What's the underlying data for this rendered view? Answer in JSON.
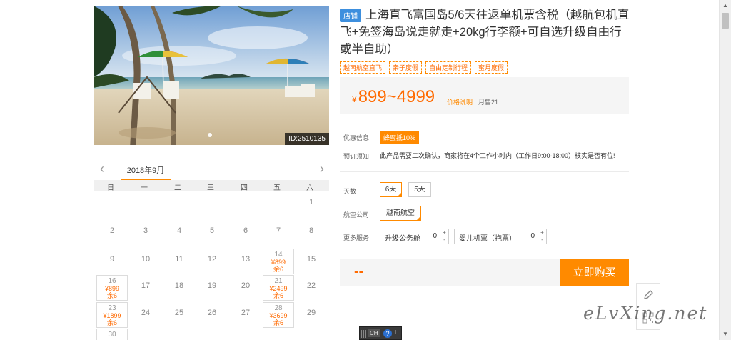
{
  "product": {
    "photo_id": "ID:2510135",
    "shop_badge": "店铺",
    "title": "上海直飞富国岛5/6天往返单机票含税（越航包机直飞+免签海岛说走就走+20kg行李额+可自选升级自由行或半自助）",
    "tags": [
      "越南航空直飞",
      "亲子度假",
      "自由定制行程",
      "蜜月度假"
    ],
    "price": {
      "currency": "¥",
      "range": "899~4999",
      "explain_link": "价格说明",
      "monthly_sales": "月售21"
    }
  },
  "info": {
    "promo_label": "优惠信息",
    "promo_badge": "蜂蜜抵10%",
    "notice_label": "预订须知",
    "notice_text": "此产品需要二次确认，商家将在4个工作小时内（工作日9:00-18:00）核实是否有位!"
  },
  "options": {
    "days_label": "天数",
    "days": [
      {
        "label": "6天",
        "selected": true
      },
      {
        "label": "5天",
        "selected": false
      }
    ],
    "airline_label": "航空公司",
    "airlines": [
      {
        "label": "越南航空",
        "selected": true
      }
    ],
    "services_label": "更多服务",
    "services": [
      {
        "label": "升级公务舱",
        "value": "0"
      },
      {
        "label": "婴儿机票（抱票）",
        "value": "0"
      }
    ]
  },
  "buy": {
    "total": "--",
    "button": "立即购买"
  },
  "calendar": {
    "prev": "‹",
    "next": "›",
    "month": "2018年9月",
    "weekdays": [
      "日",
      "一",
      "二",
      "三",
      "四",
      "五",
      "六"
    ],
    "cells": [
      {
        "day": "1",
        "row": 0,
        "col": 6
      },
      {
        "day": "2",
        "row": 1,
        "col": 0
      },
      {
        "day": "3",
        "row": 1,
        "col": 1
      },
      {
        "day": "4",
        "row": 1,
        "col": 2
      },
      {
        "day": "5",
        "row": 1,
        "col": 3
      },
      {
        "day": "6",
        "row": 1,
        "col": 4
      },
      {
        "day": "7",
        "row": 1,
        "col": 5
      },
      {
        "day": "8",
        "row": 1,
        "col": 6
      },
      {
        "day": "9",
        "row": 2,
        "col": 0
      },
      {
        "day": "10",
        "row": 2,
        "col": 1
      },
      {
        "day": "11",
        "row": 2,
        "col": 2
      },
      {
        "day": "12",
        "row": 2,
        "col": 3
      },
      {
        "day": "13",
        "row": 2,
        "col": 4
      },
      {
        "day": "14",
        "row": 2,
        "col": 5,
        "price": "¥899",
        "stock": "余6"
      },
      {
        "day": "15",
        "row": 2,
        "col": 6
      },
      {
        "day": "16",
        "row": 3,
        "col": 0,
        "price": "¥899",
        "stock": "余6"
      },
      {
        "day": "17",
        "row": 3,
        "col": 1
      },
      {
        "day": "18",
        "row": 3,
        "col": 2
      },
      {
        "day": "19",
        "row": 3,
        "col": 3
      },
      {
        "day": "20",
        "row": 3,
        "col": 4
      },
      {
        "day": "21",
        "row": 3,
        "col": 5,
        "price": "¥2499",
        "stock": "余6"
      },
      {
        "day": "22",
        "row": 3,
        "col": 6
      },
      {
        "day": "23",
        "row": 4,
        "col": 0,
        "price": "¥1899",
        "stock": "余6"
      },
      {
        "day": "24",
        "row": 4,
        "col": 1
      },
      {
        "day": "25",
        "row": 4,
        "col": 2
      },
      {
        "day": "26",
        "row": 4,
        "col": 3
      },
      {
        "day": "27",
        "row": 4,
        "col": 4
      },
      {
        "day": "28",
        "row": 4,
        "col": 5,
        "price": "¥3699",
        "stock": "余6"
      },
      {
        "day": "29",
        "row": 4,
        "col": 6
      },
      {
        "day": "30",
        "row": 5,
        "col": 0,
        "price": "",
        "stock": ""
      }
    ]
  },
  "overlay": {
    "watermark": "eLvXing.net",
    "ime_lang": "CH",
    "ime_help": "?",
    "ime_more": "⁝"
  },
  "icons": {
    "pen": "pen-icon",
    "qr": "qr-code-icon",
    "help": "help-icon"
  },
  "colors": {
    "accent": "#ff8a00",
    "price": "#ff6a00",
    "badge_blue": "#3d8fde"
  }
}
